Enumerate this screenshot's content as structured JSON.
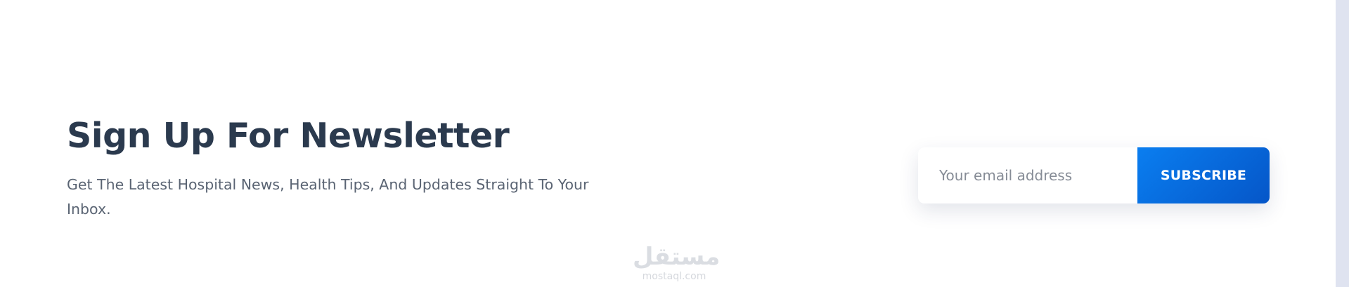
{
  "newsletter": {
    "title": "Sign Up For Newsletter",
    "subtitle": "Get The Latest Hospital News, Health Tips, And Updates Straight To Your Inbox.",
    "email_placeholder": "Your email address",
    "email_value": "",
    "subscribe_label": "SUBSCRIBE"
  },
  "watermark": {
    "arabic": "مستقل",
    "latin": "mostaql.com"
  },
  "colors": {
    "title": "#2b3a4e",
    "subtitle": "#5a6473",
    "button_start": "#0a7ef0",
    "button_end": "#0556c8",
    "scrollbar_track": "#dfe3f0"
  }
}
